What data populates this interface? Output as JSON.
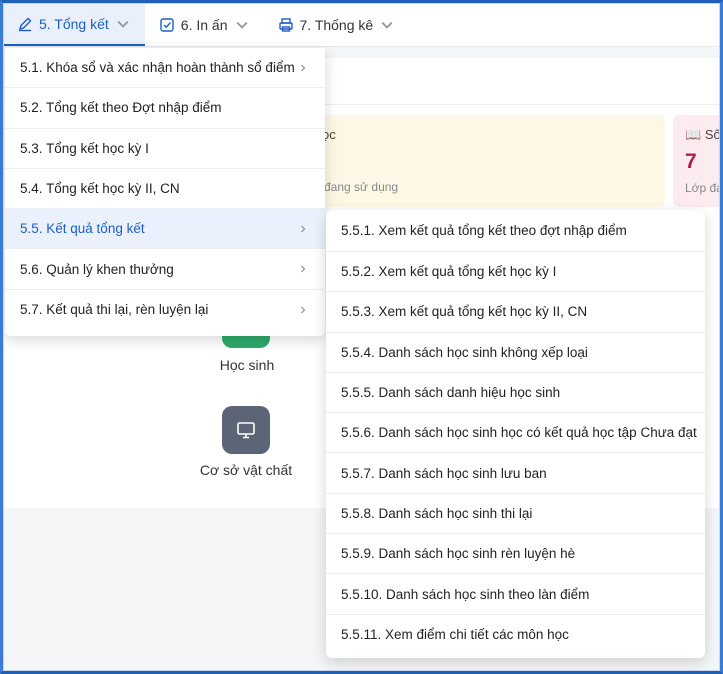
{
  "nav": {
    "items": [
      {
        "label": "5. Tổng kết",
        "icon": "pencil-icon",
        "active": true
      },
      {
        "label": "6. In ấn",
        "icon": "checkbox-icon",
        "active": false
      },
      {
        "label": "7. Thống kê",
        "icon": "printer-icon",
        "active": false
      }
    ]
  },
  "background": {
    "card_yellow": {
      "title_fragment": "ọc",
      "subtitle_fragment": "đang sử dụng"
    },
    "card_pink": {
      "title_fragment": "Số",
      "value": "7",
      "subtitle_fragment": "Lớp đa"
    },
    "tiles": [
      {
        "label": "Học sinh",
        "icon": "student-icon"
      },
      {
        "label": "Cơ sở vật chất",
        "icon": "monitor-icon"
      }
    ]
  },
  "menu": {
    "items": [
      {
        "label": "5.1. Khóa sổ và xác nhận hoàn thành sổ điểm",
        "has_submenu": true
      },
      {
        "label": "5.2. Tổng kết theo Đợt nhập điểm",
        "has_submenu": false
      },
      {
        "label": "5.3. Tổng kết học kỳ I",
        "has_submenu": false
      },
      {
        "label": "5.4. Tổng kết học kỳ II, CN",
        "has_submenu": false
      },
      {
        "label": "5.5. Kết quả tổng kết",
        "has_submenu": true,
        "selected": true
      },
      {
        "label": "5.6. Quản lý khen thưởng",
        "has_submenu": true
      },
      {
        "label": "5.7. Kết quả thi lại, rèn luyện lại",
        "has_submenu": true
      }
    ]
  },
  "submenu": {
    "items": [
      "5.5.1. Xem kết quả tổng kết theo đợt nhập điểm",
      "5.5.2. Xem kết quả tổng kết học kỳ I",
      "5.5.3. Xem kết quả tổng kết học kỳ II, CN",
      "5.5.4. Danh sách học sinh không xếp loại",
      "5.5.5. Danh sách danh hiệu học sinh",
      "5.5.6. Danh sách học sinh học có kết quả học tập Chưa đạt",
      "5.5.7. Danh sách học sinh lưu ban",
      "5.5.8. Danh sách học sinh thi lại",
      "5.5.9. Danh sách học sinh rèn luyện hè",
      "5.5.10. Danh sách học sinh theo làn điểm",
      "5.5.11. Xem điểm chi tiết các môn học"
    ]
  },
  "colors": {
    "accent": "#1d5fc4",
    "selected_bg": "#eaf1fc",
    "pink_value": "#a8204a",
    "green_tile": "#2eaa6a",
    "gray_tile": "#5b6576"
  }
}
